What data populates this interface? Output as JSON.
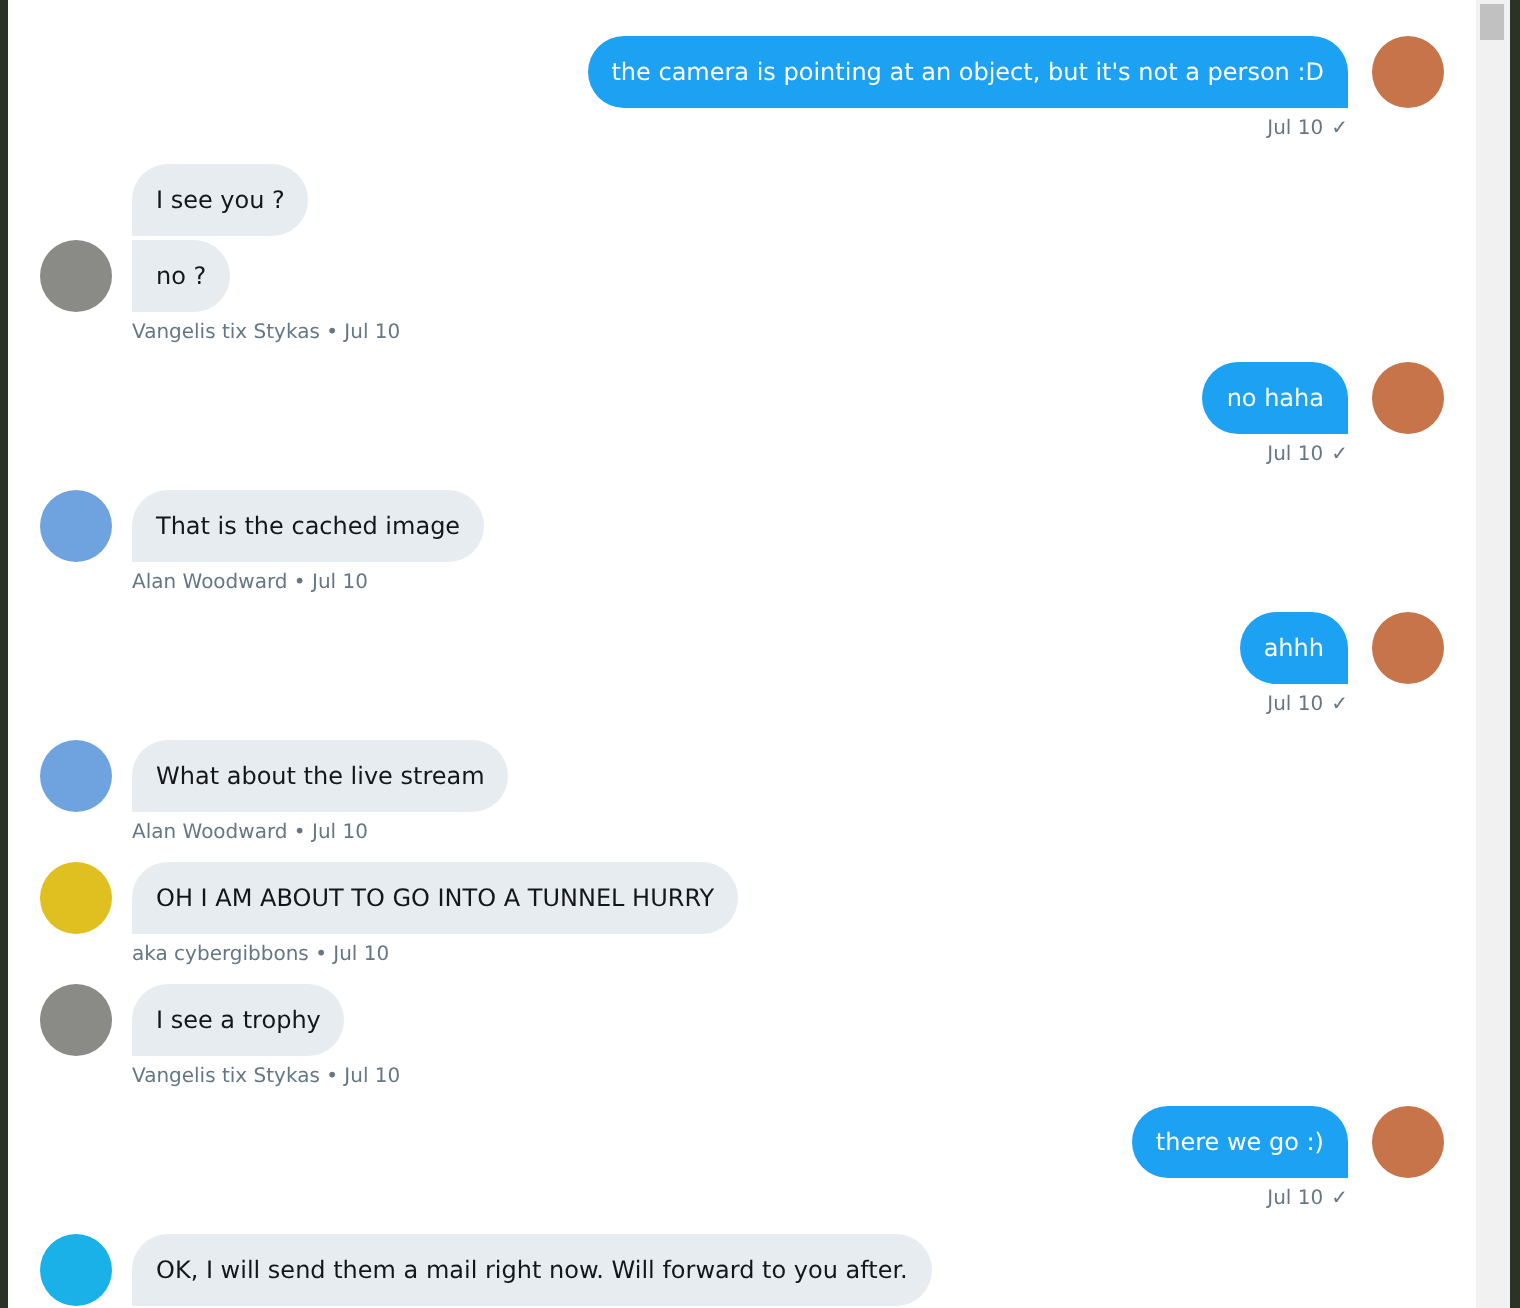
{
  "messages": [
    {
      "kind": "outgoing",
      "bubbles": [
        "the camera is pointing at an object, but it's not a person :D"
      ],
      "time": "Jul 10",
      "check": "✓"
    },
    {
      "kind": "incoming",
      "bubbles": [
        "I see you ?",
        "no ?"
      ],
      "meta": "Vangelis tix Stykas • Jul 10",
      "color": "#8a8a86"
    },
    {
      "kind": "outgoing",
      "bubbles": [
        "no haha"
      ],
      "time": "Jul 10",
      "check": "✓"
    },
    {
      "kind": "incoming",
      "bubbles": [
        "That is the cached image"
      ],
      "meta": "Alan Woodward • Jul 10",
      "color": "#6fa3e0"
    },
    {
      "kind": "outgoing",
      "bubbles": [
        "ahhh"
      ],
      "time": "Jul 10",
      "check": "✓"
    },
    {
      "kind": "incoming",
      "bubbles": [
        "What about the live stream"
      ],
      "meta": "Alan Woodward • Jul 10",
      "color": "#6fa3e0"
    },
    {
      "kind": "incoming",
      "bubbles": [
        "OH I AM ABOUT TO GO INTO A TUNNEL HURRY"
      ],
      "meta": "aka cybergibbons • Jul 10",
      "color": "#e0c020"
    },
    {
      "kind": "incoming",
      "bubbles": [
        "I see a trophy"
      ],
      "meta": "Vangelis tix Stykas • Jul 10",
      "color": "#8a8a86"
    },
    {
      "kind": "outgoing",
      "bubbles": [
        "there we go :)"
      ],
      "time": "Jul 10",
      "check": "✓"
    },
    {
      "kind": "incoming",
      "bubbles": [
        "OK, I will send them a mail right now. Will forward to you after."
      ],
      "color": "#1ab0e8"
    }
  ]
}
